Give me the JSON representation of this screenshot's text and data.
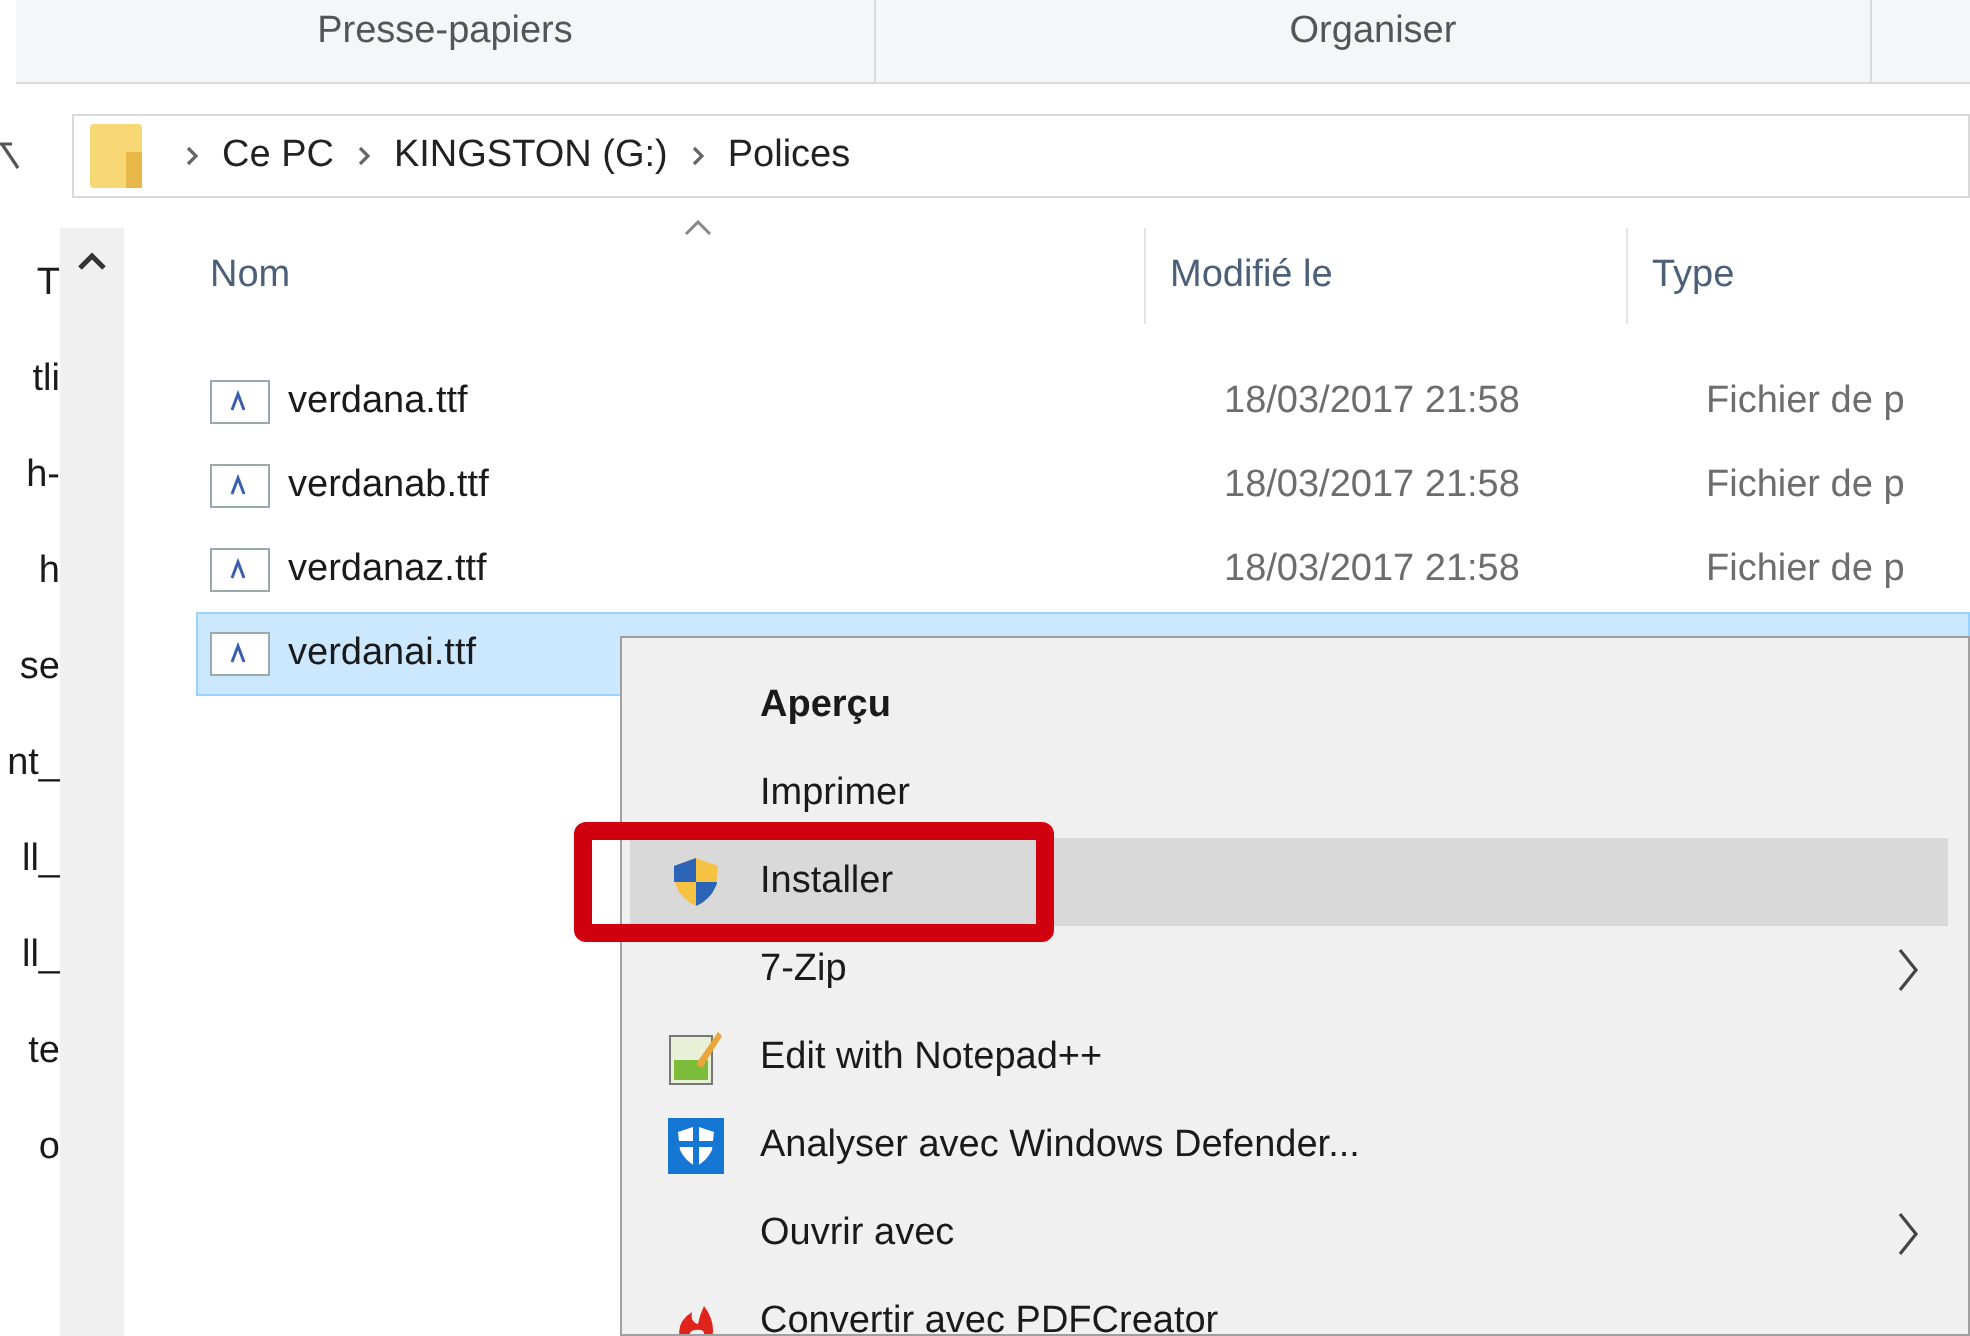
{
  "ribbon": {
    "groups": [
      "Presse-papiers",
      "Organiser"
    ]
  },
  "address_bar": {
    "path": [
      "Ce PC",
      "KINGSTON (G:)",
      "Polices"
    ]
  },
  "sidebar": {
    "items": [
      "T",
      "tli",
      "h-",
      "h",
      "se",
      "nt_",
      "ll_",
      "ll_",
      "te",
      "o"
    ]
  },
  "table": {
    "columns": [
      "Nom",
      "Modifié le",
      "Type"
    ],
    "rows": [
      {
        "name": "verdana.ttf",
        "modified": "18/03/2017 21:58",
        "type": "Fichier de p",
        "selected": false
      },
      {
        "name": "verdanab.ttf",
        "modified": "18/03/2017 21:58",
        "type": "Fichier de p",
        "selected": false
      },
      {
        "name": "verdanaz.ttf",
        "modified": "18/03/2017 21:58",
        "type": "Fichier de p",
        "selected": false
      },
      {
        "name": "verdanai.ttf",
        "selected": true
      }
    ]
  },
  "context_menu": {
    "items": [
      {
        "label": "Aperçu",
        "kind": "default",
        "submenu": false,
        "highlighted": false
      },
      {
        "label": "Imprimer",
        "kind": "plain",
        "submenu": false,
        "highlighted": false
      },
      {
        "label": "Installer",
        "kind": "shield",
        "submenu": false,
        "highlighted": true
      },
      {
        "label": "7-Zip",
        "kind": "plain",
        "submenu": true,
        "highlighted": false
      },
      {
        "label": "Edit with Notepad++",
        "kind": "notepad",
        "submenu": false,
        "highlighted": false
      },
      {
        "label": "Analyser avec Windows Defender...",
        "kind": "defender",
        "submenu": false,
        "highlighted": false
      },
      {
        "label": "Ouvrir avec",
        "kind": "plain",
        "submenu": true,
        "highlighted": false
      },
      {
        "label": "Convertir avec PDFCreator",
        "kind": "pdf",
        "submenu": false,
        "highlighted": false
      }
    ]
  },
  "annotation": {
    "kind": "highlight-box"
  }
}
